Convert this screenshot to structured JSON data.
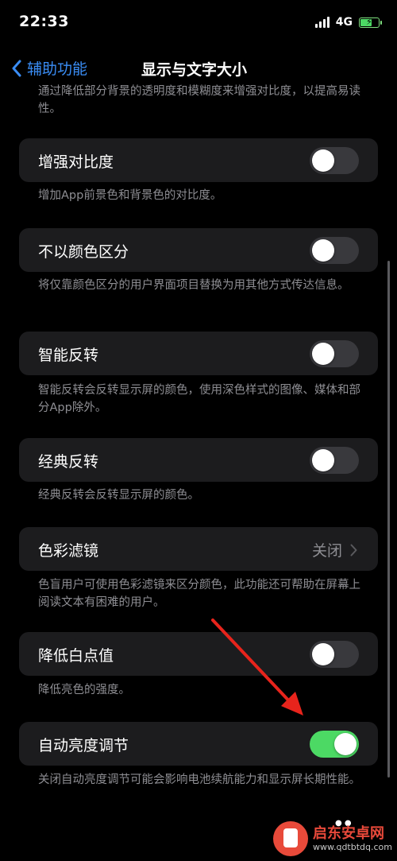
{
  "status": {
    "time": "22:33",
    "network": "4G"
  },
  "nav": {
    "back_label": "辅助功能",
    "title": "显示与文字大小"
  },
  "intro_note": "通过降低部分背景的透明度和模糊度来增强对比度，以提高易读性。",
  "settings": [
    {
      "label": "增强对比度",
      "control": "toggle",
      "on": false,
      "note": "增加App前景色和背景色的对比度。"
    },
    {
      "label": "不以颜色区分",
      "control": "toggle",
      "on": false,
      "note": "将仅靠颜色区分的用户界面项目替换为用其他方式传达信息。"
    },
    {
      "label": "智能反转",
      "control": "toggle",
      "on": false,
      "note": "智能反转会反转显示屏的颜色，使用深色样式的图像、媒体和部分App除外。"
    },
    {
      "label": "经典反转",
      "control": "toggle",
      "on": false,
      "note": "经典反转会反转显示屏的颜色。"
    },
    {
      "label": "色彩滤镜",
      "control": "disclosure",
      "value": "关闭",
      "note": "色盲用户可使用色彩滤镜来区分颜色，此功能还可帮助在屏幕上阅读文本有困难的用户。"
    },
    {
      "label": "降低白点值",
      "control": "toggle",
      "on": false,
      "note": "降低亮色的强度。"
    },
    {
      "label": "自动亮度调节",
      "control": "toggle",
      "on": true,
      "note": "关闭自动亮度调节可能会影响电池续航能力和显示屏长期性能。"
    }
  ],
  "watermark": {
    "name": "启东安卓网",
    "url": "www.qdtbtdq.com"
  },
  "colors": {
    "accent": "#3a8df5",
    "toggle_on": "#4cd964",
    "cell_bg": "#1c1c1e",
    "arrow": "#e8241c"
  }
}
